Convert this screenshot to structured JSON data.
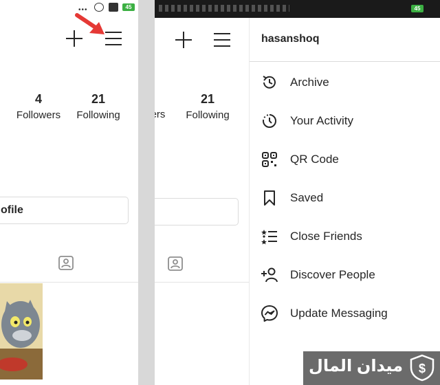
{
  "left_screen": {
    "stats": {
      "followers_count": "4",
      "followers_label": "Followers",
      "following_count": "21",
      "following_label": "Following"
    },
    "edit_profile_fragment": "ofile",
    "status_bar": {
      "battery": "45"
    }
  },
  "right_screen": {
    "stats": {
      "followers_label_fragment": "ers",
      "following_count": "21",
      "following_label": "Following"
    },
    "status_bar": {
      "battery": "45"
    },
    "menu": {
      "username": "hasanshoq",
      "items": [
        {
          "label": "Archive",
          "icon": "archive-icon"
        },
        {
          "label": "Your Activity",
          "icon": "activity-icon"
        },
        {
          "label": "QR Code",
          "icon": "qr-code-icon"
        },
        {
          "label": "Saved",
          "icon": "bookmark-icon"
        },
        {
          "label": "Close Friends",
          "icon": "close-friends-icon"
        },
        {
          "label": "Discover People",
          "icon": "discover-people-icon"
        },
        {
          "label": "Update Messaging",
          "icon": "messenger-icon"
        }
      ]
    }
  },
  "watermark": {
    "text": "ميدان المال"
  },
  "colors": {
    "text": "#262626",
    "arrow": "#e53935",
    "battery": "#3cb043",
    "watermark_bg": "#6b6b6b"
  }
}
